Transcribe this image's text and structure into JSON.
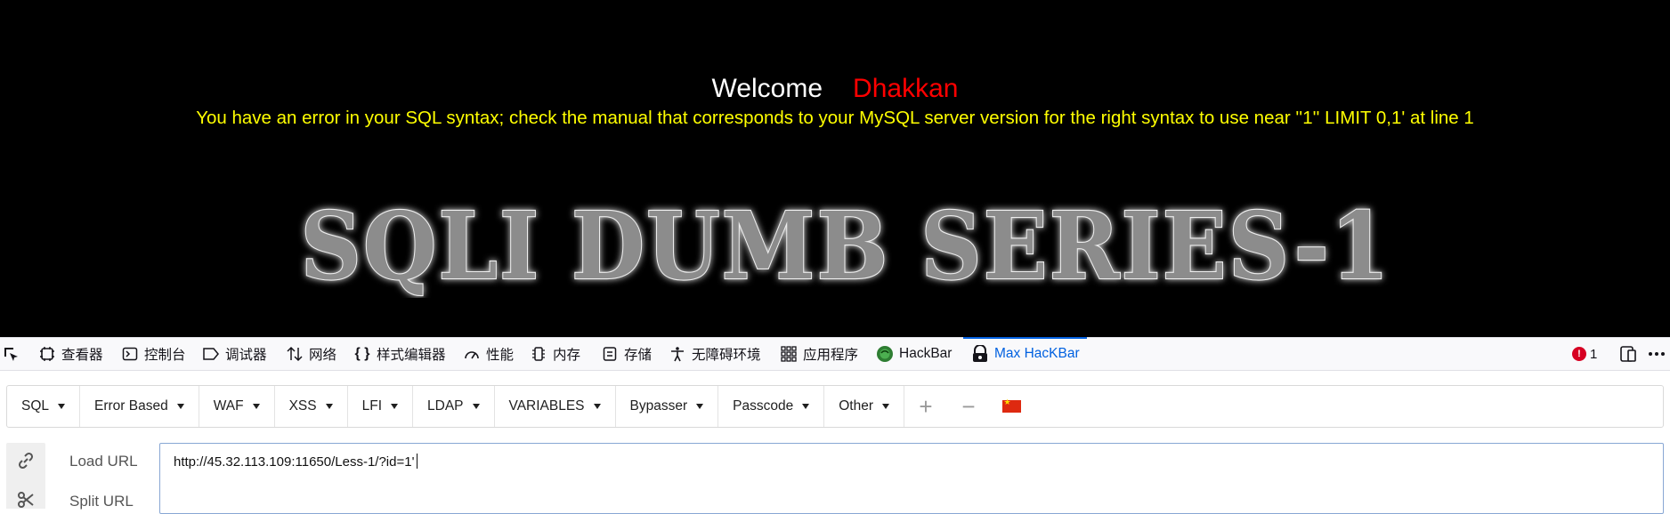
{
  "page": {
    "welcome_word": "Welcome",
    "welcome_name": "Dhakkan",
    "error_message": "You have an error in your SQL syntax; check the manual that corresponds to your MySQL server version for the right syntax to use near ''1'' LIMIT 0,1' at line 1",
    "banner_text": "SQLI DUMB SERIES-1"
  },
  "devtools": {
    "tabs": [
      {
        "label": "查看器",
        "icon": "inspector-icon"
      },
      {
        "label": "控制台",
        "icon": "console-icon"
      },
      {
        "label": "调试器",
        "icon": "debugger-icon"
      },
      {
        "label": "网络",
        "icon": "network-icon"
      },
      {
        "label": "样式编辑器",
        "icon": "style-editor-icon"
      },
      {
        "label": "性能",
        "icon": "performance-icon"
      },
      {
        "label": "内存",
        "icon": "memory-icon"
      },
      {
        "label": "存储",
        "icon": "storage-icon"
      },
      {
        "label": "无障碍环境",
        "icon": "accessibility-icon"
      },
      {
        "label": "应用程序",
        "icon": "application-icon"
      },
      {
        "label": "HackBar",
        "icon": "hackbar-icon"
      },
      {
        "label": "Max HacKBar",
        "icon": "max-hackbar-icon",
        "active": true
      }
    ],
    "error_count": "1",
    "accent_color": "#0061e0"
  },
  "hackbar": {
    "menus": [
      "SQL",
      "Error Based",
      "WAF",
      "XSS",
      "LFI",
      "LDAP",
      "VARIABLES",
      "Bypasser",
      "Passcode",
      "Other"
    ],
    "add_button": "+",
    "remove_button": "−",
    "load_url_label": "Load URL",
    "split_url_label": "Split URL",
    "url_value": "http://45.32.113.109:11650/Less-1/?id=1'"
  },
  "colors": {
    "page_bg": "#000000",
    "welcome": "#ffffff",
    "name": "#ff0000",
    "error": "#ffff00"
  }
}
